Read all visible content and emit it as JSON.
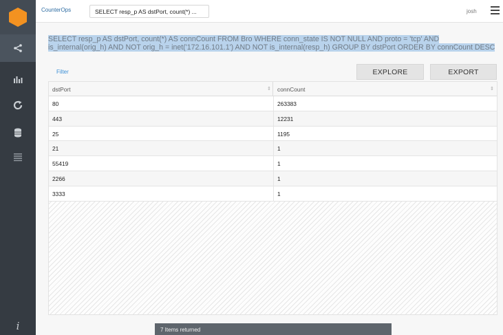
{
  "header": {
    "app_name": "CounterOps",
    "query_tab_label": "SELECT resp_p AS dstPort, count(*)  ...",
    "user": "josh"
  },
  "sidebar": {
    "items": [
      {
        "icon": "hexagon-logo-icon",
        "active": false
      },
      {
        "icon": "share-icon",
        "active": true
      },
      {
        "icon": "bar-chart-icon",
        "active": false
      },
      {
        "icon": "refresh-icon",
        "active": false
      },
      {
        "icon": "database-icon",
        "active": false
      },
      {
        "icon": "list-icon",
        "active": false
      },
      {
        "icon": "info-icon",
        "label": "i"
      }
    ]
  },
  "query": {
    "text": "SELECT resp_p AS dstPort, count(*) AS connCount FROM Bro WHERE conn_state IS NOT NULL AND proto = 'tcp' AND is_internal(orig_h) AND NOT orig_h = inet('172.16.101.1') AND NOT is_internal(resp_h) GROUP BY dstPort ORDER BY connCount DESC"
  },
  "toolbar": {
    "filter_label": "Filter",
    "explore_label": "EXPLORE",
    "export_label": "EXPORT"
  },
  "table": {
    "columns": [
      "dstPort",
      "connCount"
    ],
    "rows": [
      [
        "80",
        "263383"
      ],
      [
        "443",
        "12231"
      ],
      [
        "25",
        "1195"
      ],
      [
        "21",
        "1"
      ],
      [
        "55419",
        "1"
      ],
      [
        "2266",
        "1"
      ],
      [
        "3333",
        "1"
      ]
    ]
  },
  "status": {
    "text": "7 Items returned"
  },
  "colors": {
    "sidebar": "#353b42",
    "logo_orange": "#f39221",
    "link_blue": "#2d6ca2",
    "highlight": "#b9d3ec"
  }
}
